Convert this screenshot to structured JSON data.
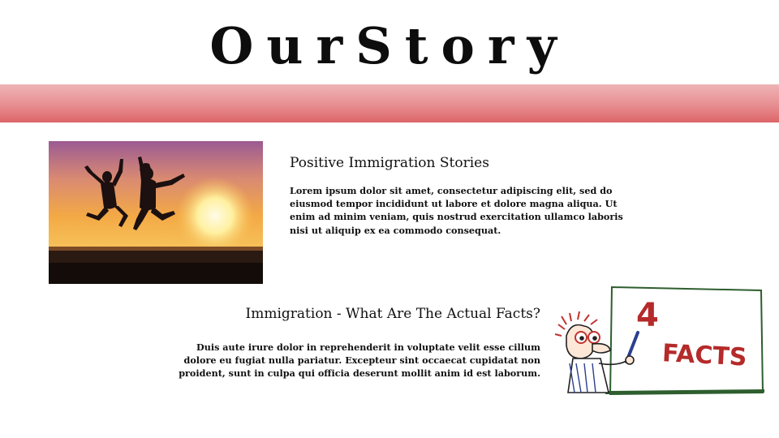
{
  "page": {
    "title": "OurStory"
  },
  "story_1": {
    "heading": "Positive Immigration Stories",
    "body": "Lorem ipsum dolor sit amet, consectetur adipiscing elit, sed do eiusmod tempor incididunt ut labore et dolore magna aliqua. Ut enim ad minim veniam, quis nostrud exercitation ullamco laboris nisi ut aliquip ex ea commodo consequat.",
    "image_icon": "jumping-people-sunset-photo"
  },
  "story_2": {
    "heading": "Immigration - What Are The Actual Facts?",
    "body": "Duis aute irure dolor in reprehenderit in voluptate velit esse cillum dolore eu fugiat nulla pariatur. Excepteur sint occaecat cupidatat non proident, sunt in culpa qui officia deserunt mollit anim id est laborum.",
    "image_icon": "cartoon-4-facts-board",
    "board_number": "4",
    "board_word": "FACTS"
  },
  "colors": {
    "band_top": "#efb4b6",
    "band_bottom": "#dc6568",
    "board_text": "#b52a2a"
  }
}
